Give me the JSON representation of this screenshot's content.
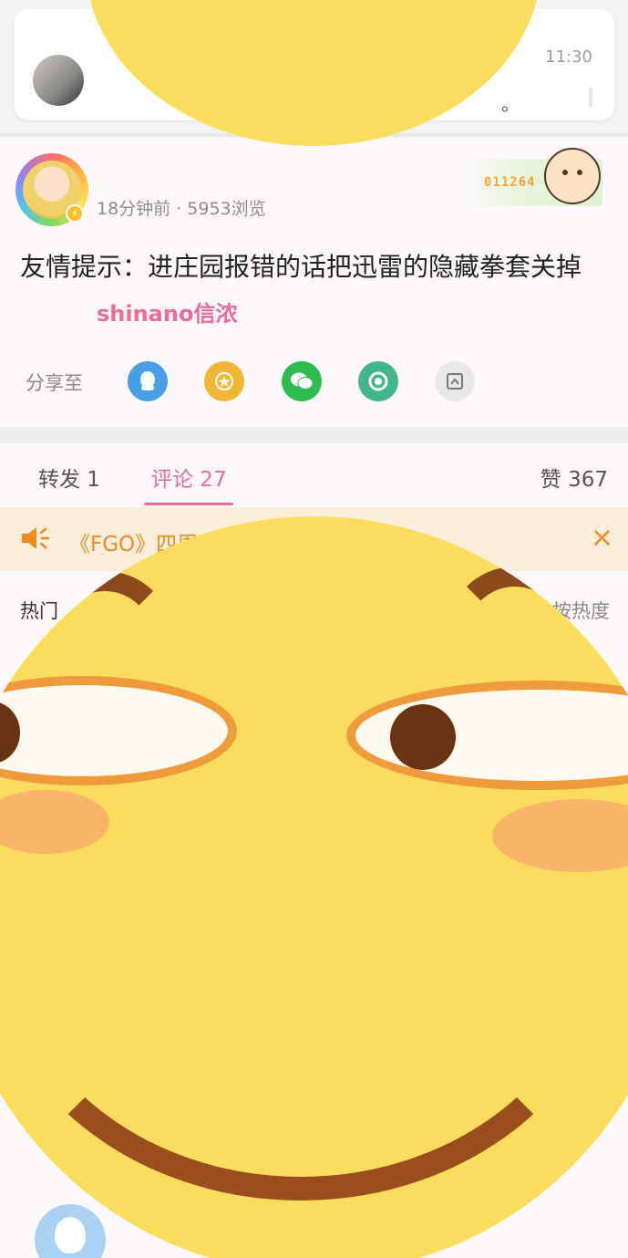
{
  "notification": {
    "time": "11:30",
    "text_tail": "。"
  },
  "post": {
    "username": "shinano信浓",
    "meta": "18分钟前 · 5953浏览",
    "decor_number": "011264",
    "content": "友情提示：进庄园报错的话把迅雷的隐藏拳套关掉",
    "share_label": "分享至",
    "share_targets": [
      "QQ",
      "QQ空间",
      "微信",
      "朋友圈",
      "更多"
    ]
  },
  "tabs": {
    "repost": "转发 1",
    "comments": "评论 27",
    "likes": "赞 367"
  },
  "notice": {
    "text": "《FGO》四周年……来观看！",
    "close": "×"
  },
  "comments": {
    "hot_label": "热门",
    "sort_label": "按热度"
  },
  "colors": {
    "accent": "#ee6c94",
    "notice_bg": "#fdeed9",
    "notice_fg": "#ef8a2b",
    "emoji": "#fcdc5c"
  }
}
